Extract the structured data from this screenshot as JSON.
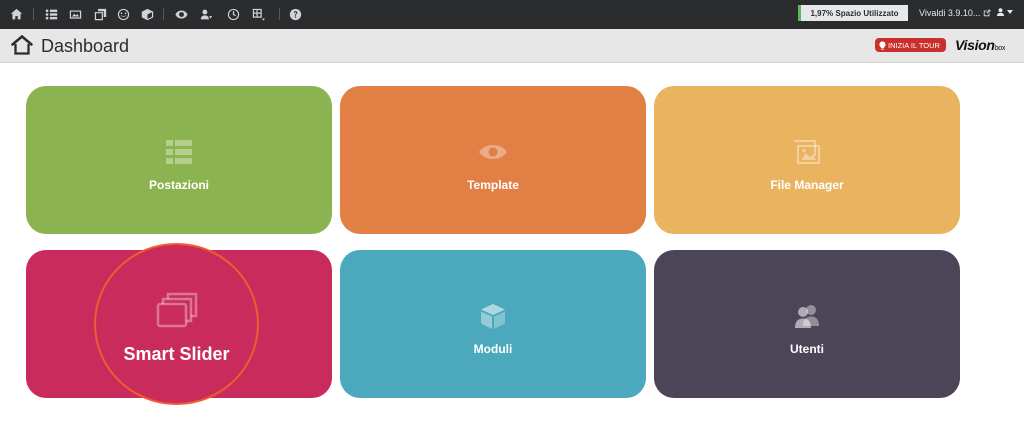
{
  "toolbar": {
    "icons": [
      "home-icon",
      "list-icon",
      "image-icon",
      "copy-icon",
      "smile-icon",
      "cube-icon",
      "eye-icon",
      "users-icon",
      "clock-icon",
      "grid-icon",
      "help-icon"
    ],
    "space_used": "1,97% Spazio Utilizzato",
    "browser_label": "Vivaldi 3.9.10...",
    "accent_color": "#5cb85c"
  },
  "header": {
    "title": "Dashboard",
    "tour_button": "INIZIA IL TOUR",
    "brand_main": "Vision",
    "brand_sub": "box"
  },
  "tiles": [
    {
      "label": "Postazioni",
      "color": "#8bb450",
      "icon": "table-icon"
    },
    {
      "label": "Template",
      "color": "#e27f45",
      "icon": "eye-icon"
    },
    {
      "label": "File Manager",
      "color": "#e9b35f",
      "icon": "images-icon"
    },
    {
      "label": "Smart Slider",
      "color": "#c92c5c",
      "icon": "stack-icon"
    },
    {
      "label": "Moduli",
      "color": "#4ca9bd",
      "icon": "cube-icon"
    },
    {
      "label": "Utenti",
      "color": "#4c4558",
      "icon": "users-icon"
    }
  ]
}
